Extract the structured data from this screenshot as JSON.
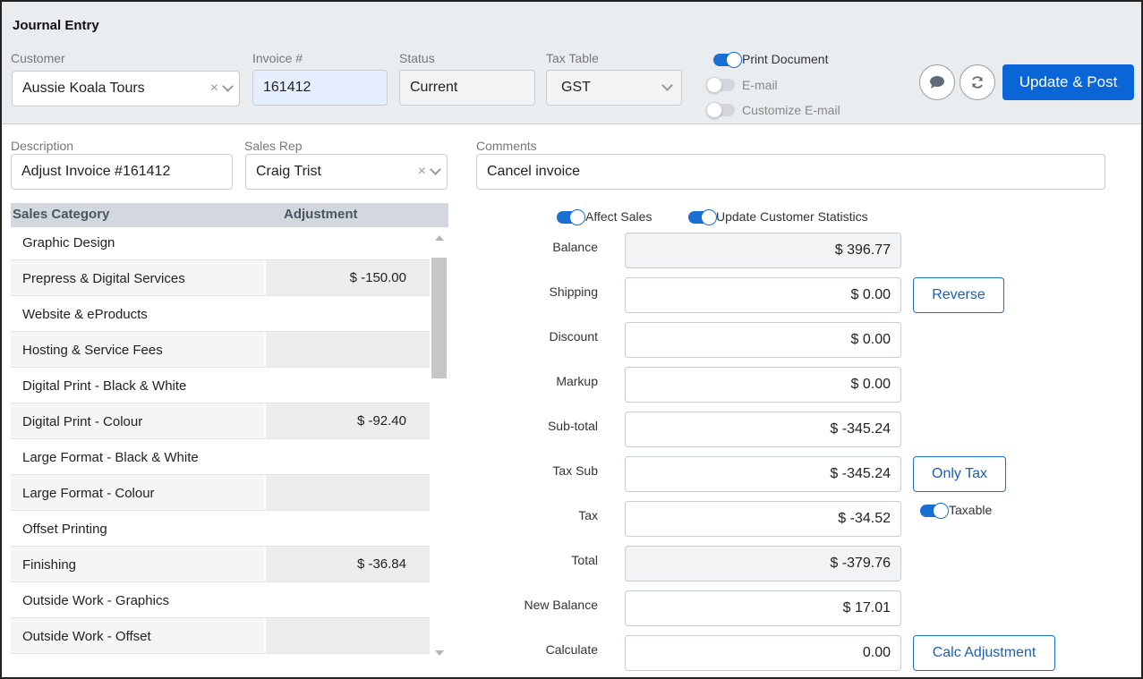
{
  "header": {
    "title": "Journal Entry",
    "customer_label": "Customer",
    "customer_value": "Aussie Koala Tours",
    "invoice_label": "Invoice #",
    "invoice_value": "161412",
    "status_label": "Status",
    "status_value": "Current",
    "tax_table_label": "Tax Table",
    "tax_table_value": "GST",
    "toggles": [
      {
        "label": "Print Document",
        "on": true
      },
      {
        "label": "E-mail",
        "on": false
      },
      {
        "label": "Customize E-mail",
        "on": false
      }
    ],
    "update_post_label": "Update & Post",
    "comment_icon": "comment-icon",
    "refresh_icon": "refresh-icon"
  },
  "form": {
    "description_label": "Description",
    "description_value": "Adjust Invoice #161412",
    "sales_rep_label": "Sales Rep",
    "sales_rep_value": "Craig Trist",
    "comments_label": "Comments",
    "comments_value": "Cancel invoice"
  },
  "table": {
    "col_category": "Sales Category",
    "col_adjustment": "Adjustment",
    "rows": [
      {
        "category": "Graphic Design",
        "adjustment": ""
      },
      {
        "category": "Prepress & Digital Services",
        "adjustment": "$ -150.00"
      },
      {
        "category": "Website & eProducts",
        "adjustment": ""
      },
      {
        "category": "Hosting & Service Fees",
        "adjustment": ""
      },
      {
        "category": "Digital Print - Black & White",
        "adjustment": ""
      },
      {
        "category": "Digital Print - Colour",
        "adjustment": "$ -92.40"
      },
      {
        "category": "Large Format - Black & White",
        "adjustment": ""
      },
      {
        "category": "Large Format - Colour",
        "adjustment": ""
      },
      {
        "category": "Offset Printing",
        "adjustment": ""
      },
      {
        "category": "Finishing",
        "adjustment": "$ -36.84"
      },
      {
        "category": "Outside Work - Graphics",
        "adjustment": ""
      },
      {
        "category": "Outside Work - Offset",
        "adjustment": ""
      }
    ]
  },
  "right": {
    "affect_sales_label": "Affect Sales",
    "affect_sales_on": true,
    "update_stats_label": "Update Customer Statistics",
    "update_stats_on": true,
    "fields": {
      "balance": {
        "label": "Balance",
        "value": "$ 396.77"
      },
      "shipping": {
        "label": "Shipping",
        "value": "$ 0.00"
      },
      "discount": {
        "label": "Discount",
        "value": "$ 0.00"
      },
      "markup": {
        "label": "Markup",
        "value": "$ 0.00"
      },
      "subtotal": {
        "label": "Sub-total",
        "value": "$ -345.24"
      },
      "taxsub": {
        "label": "Tax Sub",
        "value": "$ -345.24"
      },
      "tax": {
        "label": "Tax",
        "value": "$ -34.52"
      },
      "total": {
        "label": "Total",
        "value": "$ -379.76"
      },
      "newbalance": {
        "label": "New Balance",
        "value": "$ 17.01"
      },
      "calculate": {
        "label": "Calculate",
        "value": "0.00"
      }
    },
    "reverse_label": "Reverse",
    "only_tax_label": "Only Tax",
    "taxable_label": "Taxable",
    "taxable_on": true,
    "calc_adjustment_label": "Calc Adjustment"
  },
  "colors": {
    "primary": "#0a66d6",
    "header_bg": "#eaedf0",
    "table_head_bg": "#d2d8de"
  }
}
